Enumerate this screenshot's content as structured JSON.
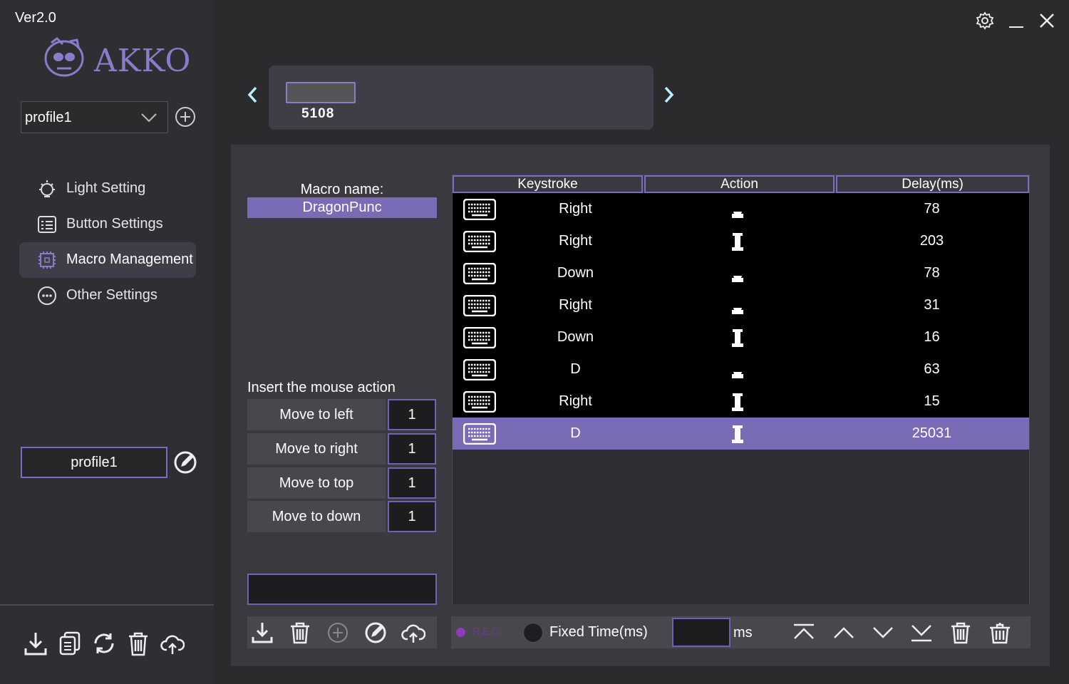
{
  "app": {
    "version": "Ver2.0",
    "logo_text": "AKKO"
  },
  "profile": {
    "selected": "profile1",
    "name_box": "profile1"
  },
  "nav": [
    {
      "label": "Light Setting",
      "icon": "bulb-icon"
    },
    {
      "label": "Button Settings",
      "icon": "keyboard-icon"
    },
    {
      "label": "Macro Management",
      "icon": "chip-icon",
      "active": true
    },
    {
      "label": "Other Settings",
      "icon": "more-icon"
    }
  ],
  "device": {
    "name": "5108"
  },
  "macro": {
    "name_label": "Macro name:",
    "name": "DragonPunc",
    "insert_label": "Insert the mouse action",
    "mouse_actions": [
      {
        "label": "Move to left",
        "value": "1"
      },
      {
        "label": "Move to right",
        "value": "1"
      },
      {
        "label": "Move to top",
        "value": "1"
      },
      {
        "label": "Move to down",
        "value": "1"
      }
    ],
    "input_value": ""
  },
  "table": {
    "headers": [
      "Keystroke",
      "Action",
      "Delay(ms)"
    ],
    "rows": [
      {
        "key": "Right",
        "action": "press",
        "delay": "78"
      },
      {
        "key": "Right",
        "action": "release",
        "delay": "203"
      },
      {
        "key": "Down",
        "action": "press",
        "delay": "78"
      },
      {
        "key": "Right",
        "action": "press",
        "delay": "31"
      },
      {
        "key": "Down",
        "action": "release",
        "delay": "16"
      },
      {
        "key": "D",
        "action": "press",
        "delay": "63"
      },
      {
        "key": "Right",
        "action": "release",
        "delay": "15"
      },
      {
        "key": "D",
        "action": "release",
        "delay": "25031",
        "selected": true
      }
    ]
  },
  "bottom": {
    "rec": "REC",
    "fixed_time_label": "Fixed Time(ms)",
    "fixed_time_value": "",
    "ms_label": "ms"
  },
  "colors": {
    "accent": "#7a6bb6",
    "border": "#7a6bc0",
    "rec": "#8e3db8"
  }
}
